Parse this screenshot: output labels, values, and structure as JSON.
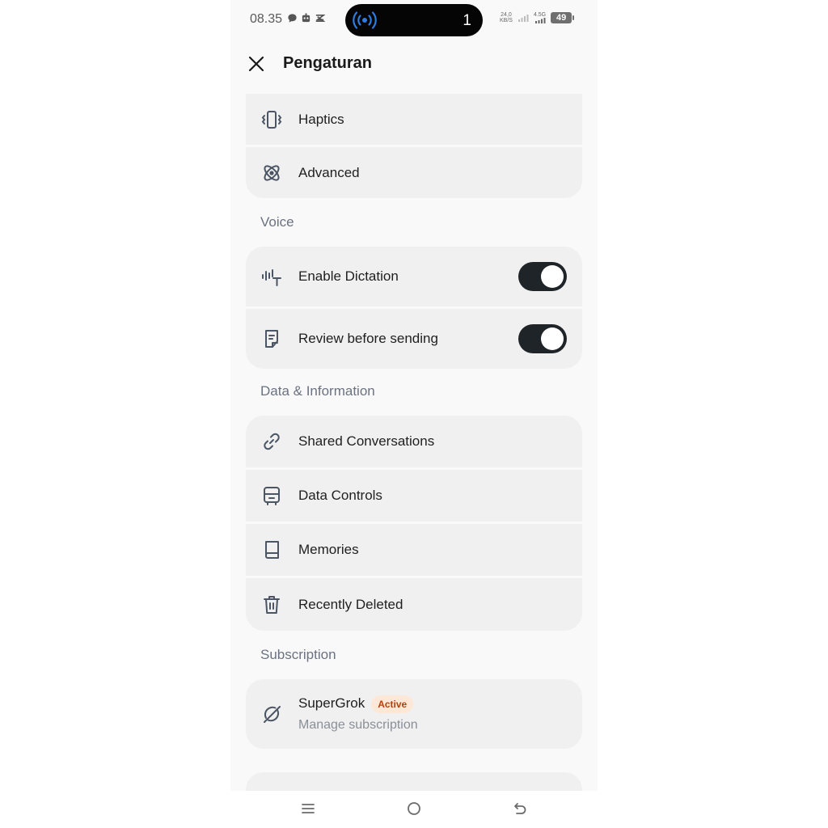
{
  "status": {
    "time": "08.35",
    "notification_count": "1",
    "net_speed": "24,0",
    "net_unit": "KB/S",
    "network": "4.5G",
    "battery": "49"
  },
  "header": {
    "title": "Pengaturan"
  },
  "general": {
    "items": [
      {
        "label": "Haptics",
        "icon": "vibration-icon"
      },
      {
        "label": "Advanced",
        "icon": "atom-icon"
      }
    ]
  },
  "voice": {
    "section_label": "Voice",
    "items": [
      {
        "label": "Enable Dictation",
        "icon": "waveform-text-icon",
        "enabled": true
      },
      {
        "label": "Review before sending",
        "icon": "document-edit-icon",
        "enabled": true
      }
    ]
  },
  "data_info": {
    "section_label": "Data & Information",
    "items": [
      {
        "label": "Shared Conversations",
        "icon": "link-icon"
      },
      {
        "label": "Data Controls",
        "icon": "database-icon"
      },
      {
        "label": "Memories",
        "icon": "book-icon"
      },
      {
        "label": "Recently Deleted",
        "icon": "trash-icon"
      }
    ]
  },
  "subscription": {
    "section_label": "Subscription",
    "title": "SuperGrok",
    "badge": "Active",
    "description": "Manage subscription",
    "icon": "grok-logo-icon"
  },
  "colors": {
    "toggle_on": "#1f2428",
    "badge_bg": "#fde8d8",
    "badge_text": "#b4410d",
    "pill_accent": "#2f7de1"
  }
}
